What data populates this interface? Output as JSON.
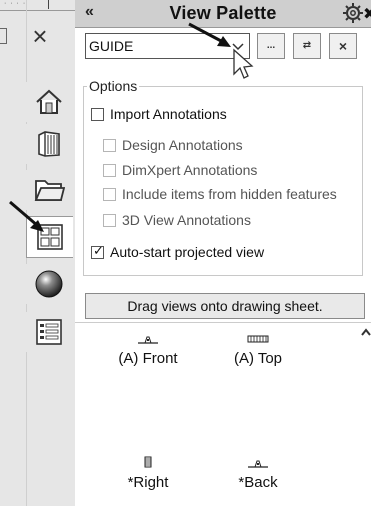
{
  "palette": {
    "title": "View Palette",
    "collapse_glyph": "«",
    "pin_glyph": "✖",
    "document_value": "GUIDE",
    "browse_label": "...",
    "refresh_label": "⇄",
    "close_label": "×"
  },
  "options": {
    "legend": "Options",
    "import_annotations": {
      "label": "Import Annotations",
      "checked": false
    },
    "design_annotations": {
      "label": "Design Annotations",
      "checked": false,
      "enabled": false
    },
    "dimxpert_annotations": {
      "label": "DimXpert Annotations",
      "checked": false,
      "enabled": false
    },
    "hidden_features": {
      "label": "Include items from hidden features",
      "checked": false,
      "enabled": false
    },
    "view_3d_annotations": {
      "label": "3D View Annotations",
      "checked": false,
      "enabled": false
    },
    "auto_start": {
      "label": "Auto-start projected view",
      "checked": true
    }
  },
  "drag_bar": {
    "label": "Drag views onto drawing sheet."
  },
  "views": [
    {
      "label": "(A) Front"
    },
    {
      "label": "(A) Top"
    },
    {
      "label": "*Right"
    },
    {
      "label": "*Back"
    }
  ],
  "left_strip": {
    "close_glyph": "×",
    "tabs": [
      "home-icon",
      "design-library-icon",
      "file-explorer-icon",
      "view-palette-icon",
      "appearances-icon",
      "custom-properties-icon"
    ]
  }
}
